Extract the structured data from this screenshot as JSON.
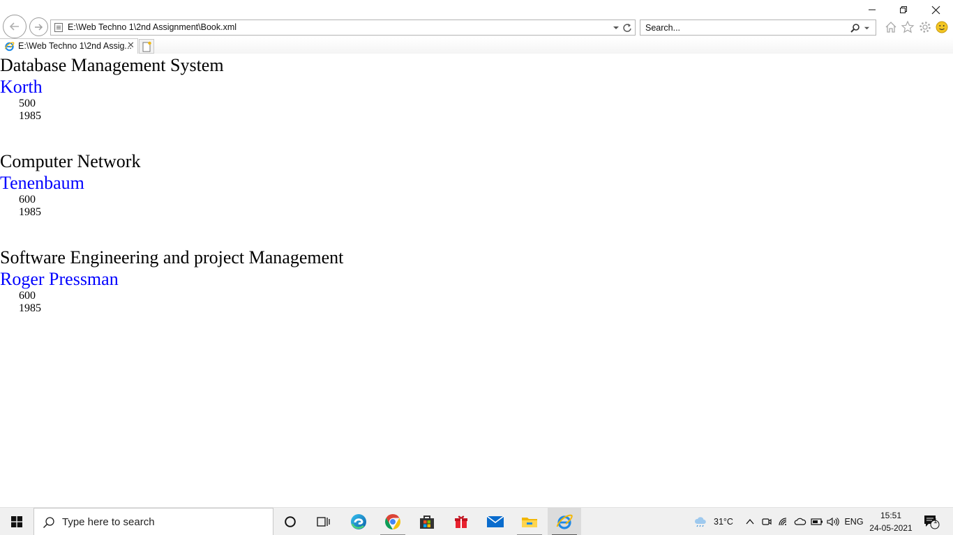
{
  "browser": {
    "address": "E:\\Web Techno 1\\2nd Assignment\\Book.xml",
    "search_placeholder": "Search...",
    "tab_title": "E:\\Web Techno 1\\2nd Assig...",
    "tab_close_glyph": "✕"
  },
  "books": [
    {
      "title": "Database Management System",
      "author": "Korth",
      "price": "500",
      "year": "1985"
    },
    {
      "title": "Computer Network",
      "author": "Tenenbaum",
      "price": "600",
      "year": "1985"
    },
    {
      "title": "Software Engineering and project Management",
      "author": "Roger Pressman",
      "price": "600",
      "year": "1985"
    }
  ],
  "taskbar": {
    "search_text": "Type here to search",
    "apps": [
      "cortana-icon",
      "task-view-icon",
      "edge-icon",
      "chrome-icon",
      "store-icon",
      "gift-icon",
      "mail-icon",
      "file-explorer-icon",
      "internet-explorer-icon"
    ],
    "weather": "31°C",
    "language": "ENG",
    "time": "15:51",
    "date": "24-05-2021",
    "notification_count": "1"
  },
  "colors": {
    "author_link": "#0000ff",
    "taskbar_bg": "#f0f0f0"
  }
}
